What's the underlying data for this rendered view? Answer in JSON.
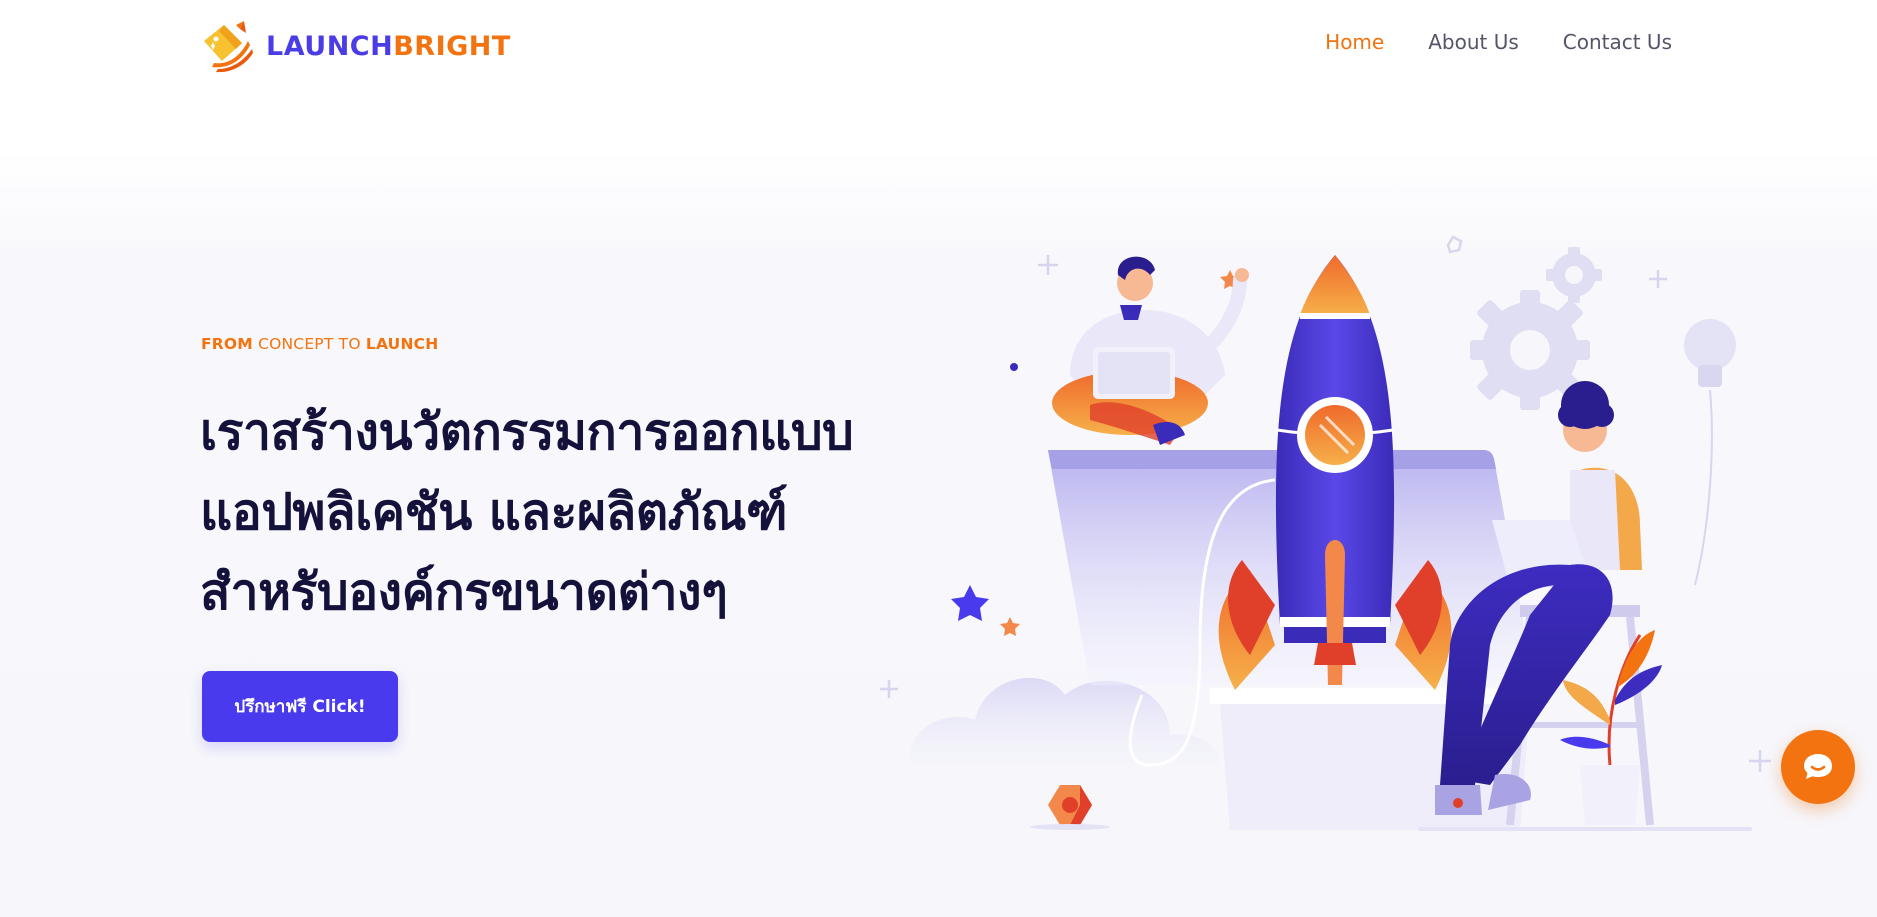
{
  "brand": {
    "name_part1": "LAUNCH",
    "name_part2": "BRIGHT",
    "colors": {
      "primary": "#4b3de6",
      "accent": "#f2730f",
      "text": "#14123a"
    }
  },
  "nav": {
    "items": [
      {
        "label": "Home",
        "active": true
      },
      {
        "label": "About Us",
        "active": false
      },
      {
        "label": "Contact Us",
        "active": false
      }
    ]
  },
  "hero": {
    "kicker": {
      "part1": "FROM",
      "part2": "CONCEPT TO",
      "part3": "LAUNCH"
    },
    "headline_lines": [
      "เราสร้างนวัตกรรมการออกแบบ",
      "แอปพลิเคชัน และผลิตภัณฑ์",
      "สำหรับองค์กรขนาดต่างๆ"
    ],
    "cta_label": "ปรึกษาฟรี Click!"
  },
  "icons": {
    "logo": "rocket-logo-icon",
    "chat": "chat-bubble-icon",
    "illustration": "rocket-launch-illustration"
  }
}
